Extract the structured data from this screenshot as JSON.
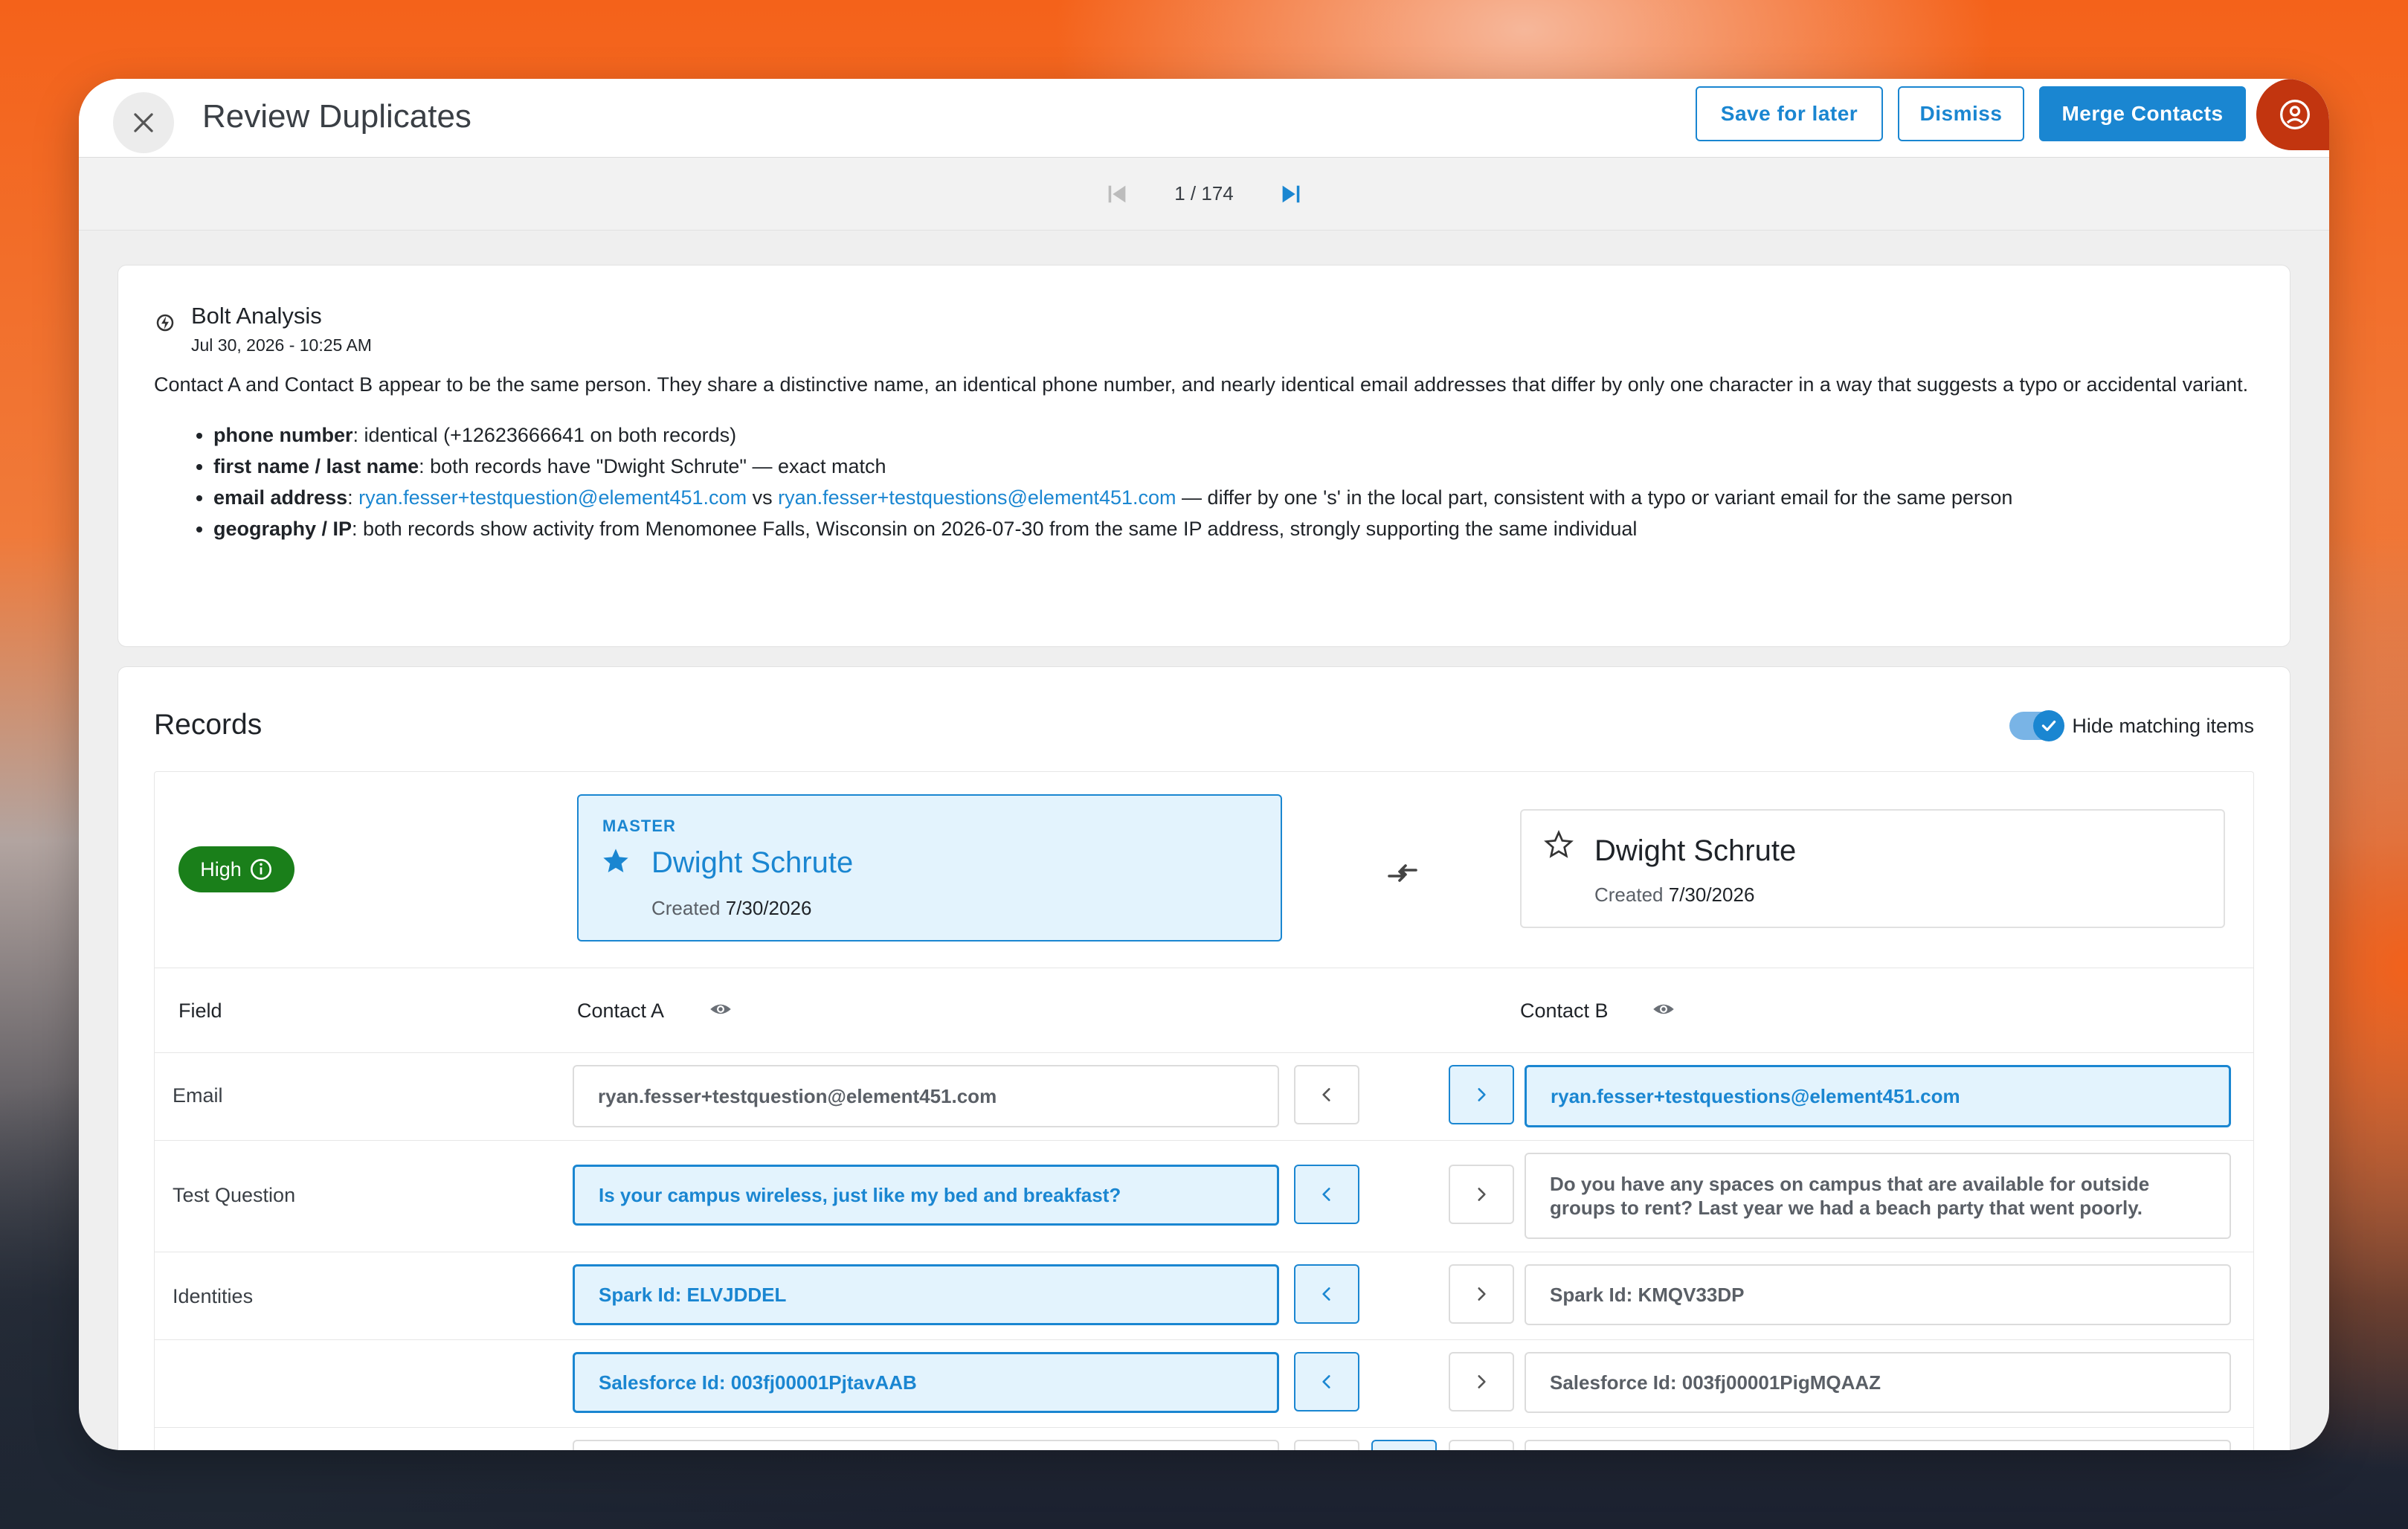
{
  "header": {
    "title": "Review Duplicates",
    "save_label": "Save for later",
    "dismiss_label": "Dismiss",
    "merge_label": "Merge Contacts"
  },
  "pager": {
    "count": "1 / 174"
  },
  "analysis": {
    "title": "Bolt Analysis",
    "date": "Jul 30, 2026 - 10:25 AM",
    "summary": "Contact A and Contact B appear to be the same person. They share a distinctive name, an identical phone number, and nearly identical email addresses that differ by only one character in a way that suggests a typo or accidental variant.",
    "bullets": [
      {
        "label": "phone number",
        "text": ": identical (+12623666641 on both records)"
      },
      {
        "label": "first name / last name",
        "text": ": both records have \"Dwight Schrute\" — exact match"
      },
      {
        "label": "email address",
        "text_a": ": ",
        "email_a": "ryan.fesser+testquestion@element451.com",
        "mid": " vs ",
        "email_b": "ryan.fesser+testquestions@element451.com",
        "text_b": " — differ by one 's' in the local part, consistent with a typo or variant email for the same person"
      },
      {
        "label": "geography / IP",
        "text": ": both records show activity from Menomonee Falls, Wisconsin on 2026-07-30 from the same IP address, strongly supporting the same individual"
      }
    ]
  },
  "records": {
    "title": "Records",
    "toggle_label": "Hide matching items",
    "toggle_on": true,
    "confidence": "High",
    "master": {
      "label": "MASTER",
      "name": "Dwight Schrute",
      "created_label": "Created",
      "created_date": "7/30/2026"
    },
    "other": {
      "name": "Dwight Schrute",
      "created_label": "Created",
      "created_date": "7/30/2026"
    },
    "columns": {
      "field": "Field",
      "contact_a": "Contact A",
      "contact_b": "Contact B"
    },
    "rows": [
      {
        "field": "Email",
        "a": "ryan.fesser+testquestion@element451.com",
        "b": "ryan.fesser+testquestions@element451.com",
        "selected": "b"
      },
      {
        "field": "Test Question",
        "a": "Is your campus wireless, just like my bed and breakfast?",
        "b": "Do you have any spaces on campus that are available for outside groups to rent? Last year we had a beach party that went poorly.",
        "selected": "a"
      },
      {
        "field": "Identities",
        "a": "Spark Id: ELVJDDEL",
        "b": "Spark Id: KMQV33DP",
        "selected": "a"
      },
      {
        "field": "",
        "a": "Salesforce Id: 003fj00001PjtavAAB",
        "b": "Salesforce Id: 003fj00001PigMQAAZ",
        "selected": "a"
      }
    ]
  },
  "colors": {
    "accent": "#1a86d1",
    "high_badge": "#1a7f1a",
    "selected_bg": "#e3f3fd"
  }
}
